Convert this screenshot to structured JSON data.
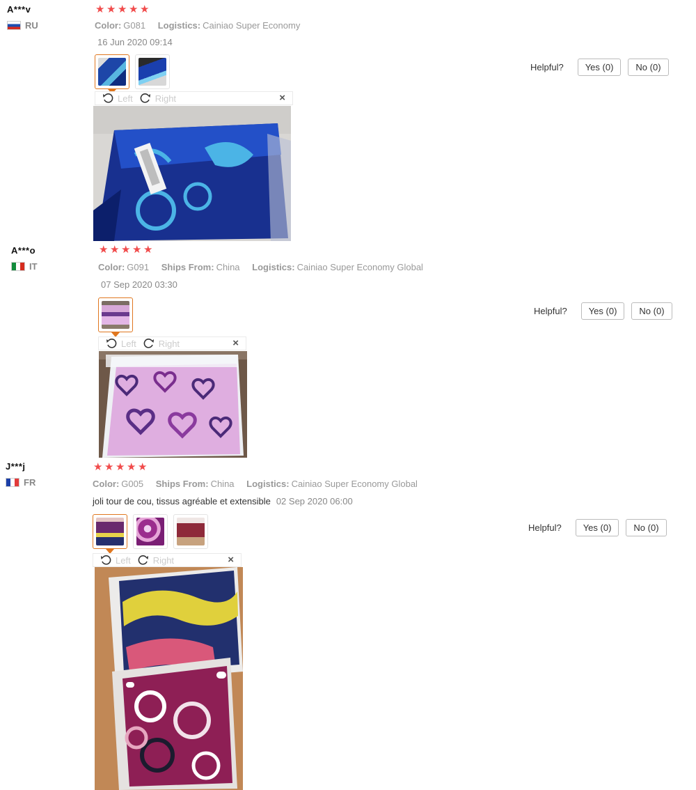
{
  "labels": {
    "color": "Color:",
    "ships_from": "Ships From:",
    "logistics": "Logistics:",
    "helpful": "Helpful?",
    "left": "Left",
    "right": "Right",
    "close": "×"
  },
  "reviews": [
    {
      "user": "A***v",
      "country": "RU",
      "rating": 5,
      "color": "G081",
      "logistics": "Cainiao Super Economy",
      "date": "16 Jun 2020 09:14",
      "yes": "Yes (0)",
      "no": "No (0)"
    },
    {
      "user": "A***o",
      "country": "IT",
      "rating": 5,
      "color": "G091",
      "ships_from": "China",
      "logistics": "Cainiao Super Economy Global",
      "date": "07 Sep 2020 03:30",
      "yes": "Yes (0)",
      "no": "No (0)"
    },
    {
      "user": "J***j",
      "country": "FR",
      "rating": 5,
      "color": "G005",
      "ships_from": "China",
      "logistics": "Cainiao Super Economy Global",
      "feedback": "joli tour de cou, tissus agréable et extensible",
      "date": "02 Sep 2020 06:00",
      "yes": "Yes (0)",
      "no": "No (0)"
    }
  ],
  "colors": {
    "star": "#f14b4b",
    "active_thumb_border": "#e0771f"
  }
}
